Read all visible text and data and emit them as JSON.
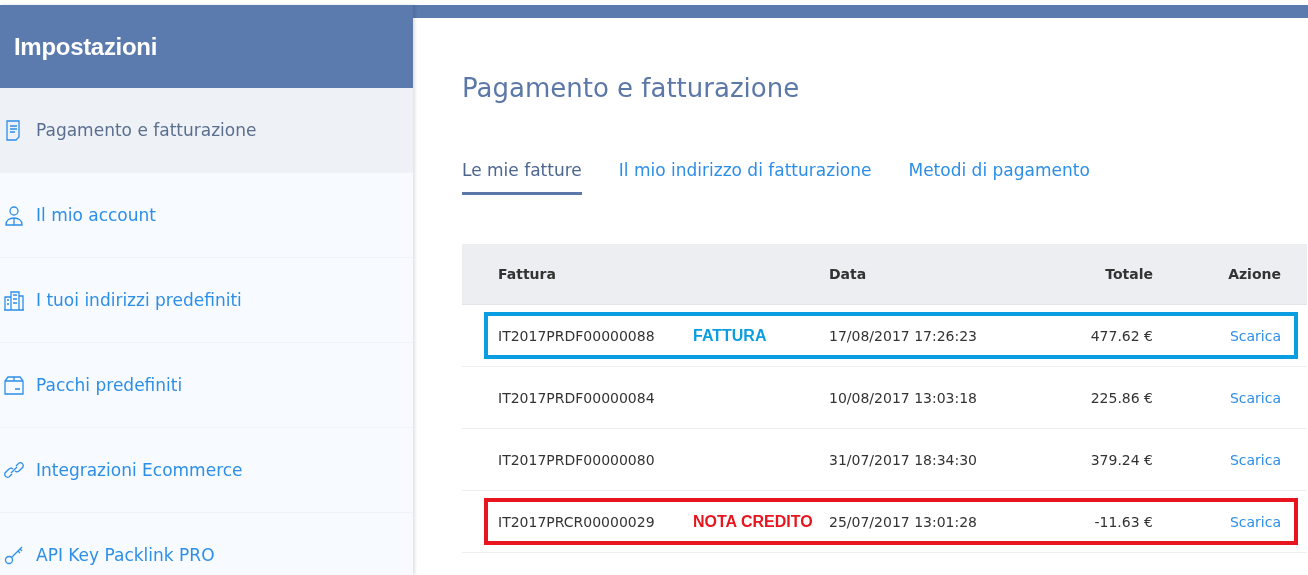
{
  "sidebar": {
    "title": "Impostazioni",
    "items": [
      {
        "label": "Pagamento e fatturazione",
        "selected": true
      },
      {
        "label": "Il mio account",
        "selected": false
      },
      {
        "label": "I tuoi indirizzi predefiniti",
        "selected": false
      },
      {
        "label": "Pacchi predefiniti",
        "selected": false
      },
      {
        "label": "Integrazioni Ecommerce",
        "selected": false
      },
      {
        "label": "API Key Packlink PRO",
        "selected": false
      }
    ]
  },
  "page": {
    "title": "Pagamento e fatturazione",
    "tabs": [
      {
        "label": "Le mie fatture",
        "selected": true
      },
      {
        "label": "Il mio indirizzo di fatturazione",
        "selected": false
      },
      {
        "label": "Metodi di pagamento",
        "selected": false
      }
    ],
    "table": {
      "columns": [
        "Fattura",
        "Data",
        "Totale",
        "Azione"
      ],
      "rows": [
        {
          "invoice": "IT2017PRDF00000088",
          "tag": "FATTURA",
          "color": "#0a9ee0",
          "date": "17/08/2017 17:26:23",
          "total": "477.62 €",
          "action": "Scarica"
        },
        {
          "invoice": "IT2017PRDF00000084",
          "date": "10/08/2017 13:03:18",
          "total": "225.86 €",
          "action": "Scarica"
        },
        {
          "invoice": "IT2017PRDF00000080",
          "date": "31/07/2017 18:34:30",
          "total": "379.24 €",
          "action": "Scarica"
        },
        {
          "invoice": "IT2017PRCR00000029",
          "tag": "NOTA CREDITO",
          "color": "#e8141e",
          "date": "25/07/2017 13:01:28",
          "total": "-11.63 €",
          "action": "Scarica"
        }
      ]
    }
  }
}
